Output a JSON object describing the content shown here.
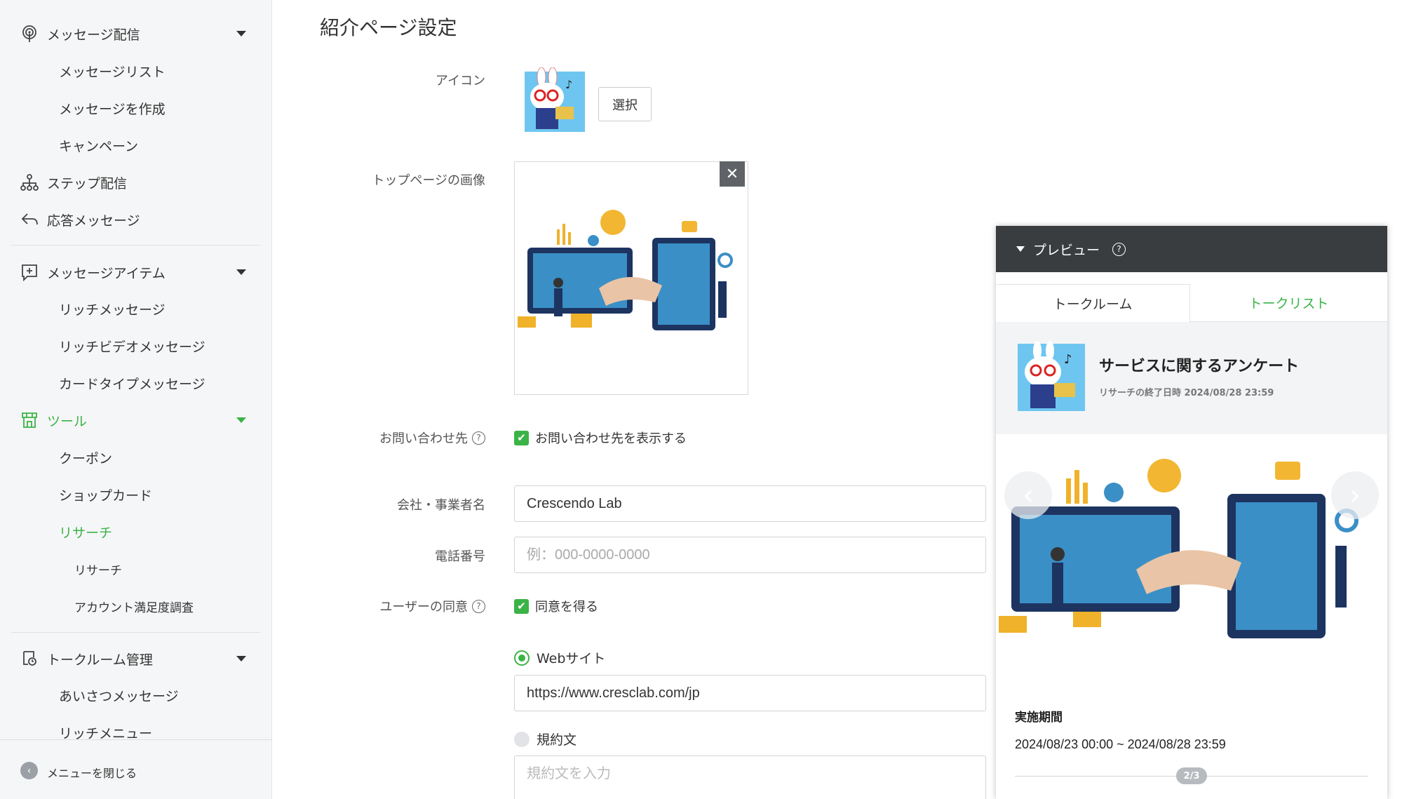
{
  "sidebar": {
    "items": [
      {
        "label": "メッセージ配信"
      },
      {
        "label": "メッセージリスト"
      },
      {
        "label": "メッセージを作成"
      },
      {
        "label": "キャンペーン"
      },
      {
        "label": "ステップ配信"
      },
      {
        "label": "応答メッセージ"
      },
      {
        "label": "メッセージアイテム"
      },
      {
        "label": "リッチメッセージ"
      },
      {
        "label": "リッチビデオメッセージ"
      },
      {
        "label": "カードタイプメッセージ"
      },
      {
        "label": "ツール"
      },
      {
        "label": "クーポン"
      },
      {
        "label": "ショップカード"
      },
      {
        "label": "リサーチ"
      },
      {
        "label": "リサーチ"
      },
      {
        "label": "アカウント満足度調査"
      },
      {
        "label": "トークルーム管理"
      },
      {
        "label": "あいさつメッセージ"
      },
      {
        "label": "リッチメニュー"
      }
    ],
    "collapse_label": "メニューを閉じる",
    "accent_color": "#3bb346"
  },
  "main": {
    "title": "紹介ページ設定",
    "icon_label": "アイコン",
    "select_button": "選択",
    "top_image_label": "トップページの画像",
    "contact_label": "お問い合わせ先",
    "contact_checkbox": "お問い合わせ先を表示する",
    "company_label": "会社・事業者名",
    "company_value": "Crescendo Lab",
    "phone_label": "電話番号",
    "phone_placeholder": "例：000-0000-0000",
    "consent_label": "ユーザーの同意",
    "consent_checkbox": "同意を得る",
    "website_radio": "Webサイト",
    "website_value": "https://www.cresclab.com/jp",
    "terms_radio": "規約文",
    "terms_placeholder": "規約文を入力"
  },
  "preview": {
    "header": "プレビュー",
    "tab_talkroom": "トークルーム",
    "tab_talklist": "トークリスト",
    "survey_title": "サービスに関するアンケート",
    "survey_end": "リサーチの終了日時 2024/08/28 23:59",
    "period_label": "実施期間",
    "period_value": "2024/08/23 00:00 ~ 2024/08/28 23:59",
    "page_indicator": "2/3"
  }
}
